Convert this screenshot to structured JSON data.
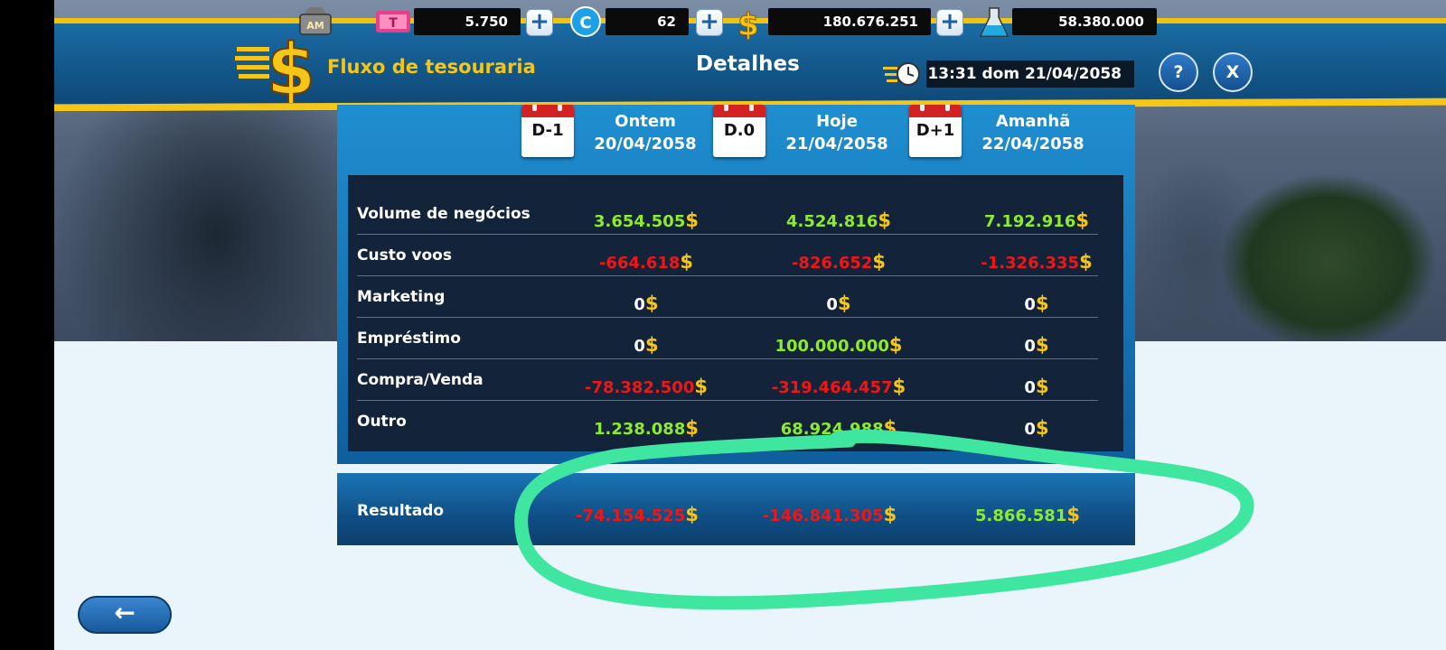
{
  "header": {
    "title": "Fluxo de tesouraria",
    "subtitle": "Detalhes",
    "datetime": "13:31 dom 21/04/2058",
    "help_label": "?",
    "close_label": "X"
  },
  "resources": {
    "tickets": "5.750",
    "coins": "62",
    "money": "180.676.251",
    "research": "58.380.000",
    "plus_label": "+"
  },
  "columns": [
    {
      "badge": "D-1",
      "label": "Ontem",
      "date": "20/04/2058"
    },
    {
      "badge": "D.0",
      "label": "Hoje",
      "date": "21/04/2058"
    },
    {
      "badge": "D+1",
      "label": "Amanhã",
      "date": "22/04/2058"
    }
  ],
  "currency_symbol": "$",
  "rows": [
    {
      "label": "Volume de negócios",
      "values": [
        "3.654.505",
        "4.524.816",
        "7.192.916"
      ],
      "tones": [
        "pos",
        "pos",
        "pos"
      ]
    },
    {
      "label": "Custo voos",
      "values": [
        "-664.618",
        "-826.652",
        "-1.326.335"
      ],
      "tones": [
        "neg",
        "neg",
        "neg"
      ]
    },
    {
      "label": "Marketing",
      "values": [
        "0",
        "0",
        "0"
      ],
      "tones": [
        "zero",
        "zero",
        "zero"
      ]
    },
    {
      "label": "Empréstimo",
      "values": [
        "0",
        "100.000.000",
        "0"
      ],
      "tones": [
        "zero",
        "pos",
        "zero"
      ]
    },
    {
      "label": "Compra/Venda",
      "values": [
        "-78.382.500",
        "-319.464.457",
        "0"
      ],
      "tones": [
        "neg",
        "neg",
        "zero"
      ]
    },
    {
      "label": "Outro",
      "values": [
        "1.238.088",
        "68.924.988",
        "0"
      ],
      "tones": [
        "pos",
        "pos",
        "zero"
      ]
    }
  ],
  "result": {
    "label": "Resultado",
    "values": [
      "-74.154.525",
      "-146.841.305",
      "5.866.581"
    ],
    "tones": [
      "neg",
      "neg",
      "pos"
    ]
  },
  "back_label": "←",
  "colors": {
    "positive": "#8dea2c",
    "negative": "#f01616",
    "accent_gold": "#f5c518",
    "annotation": "#3ee6a0"
  }
}
